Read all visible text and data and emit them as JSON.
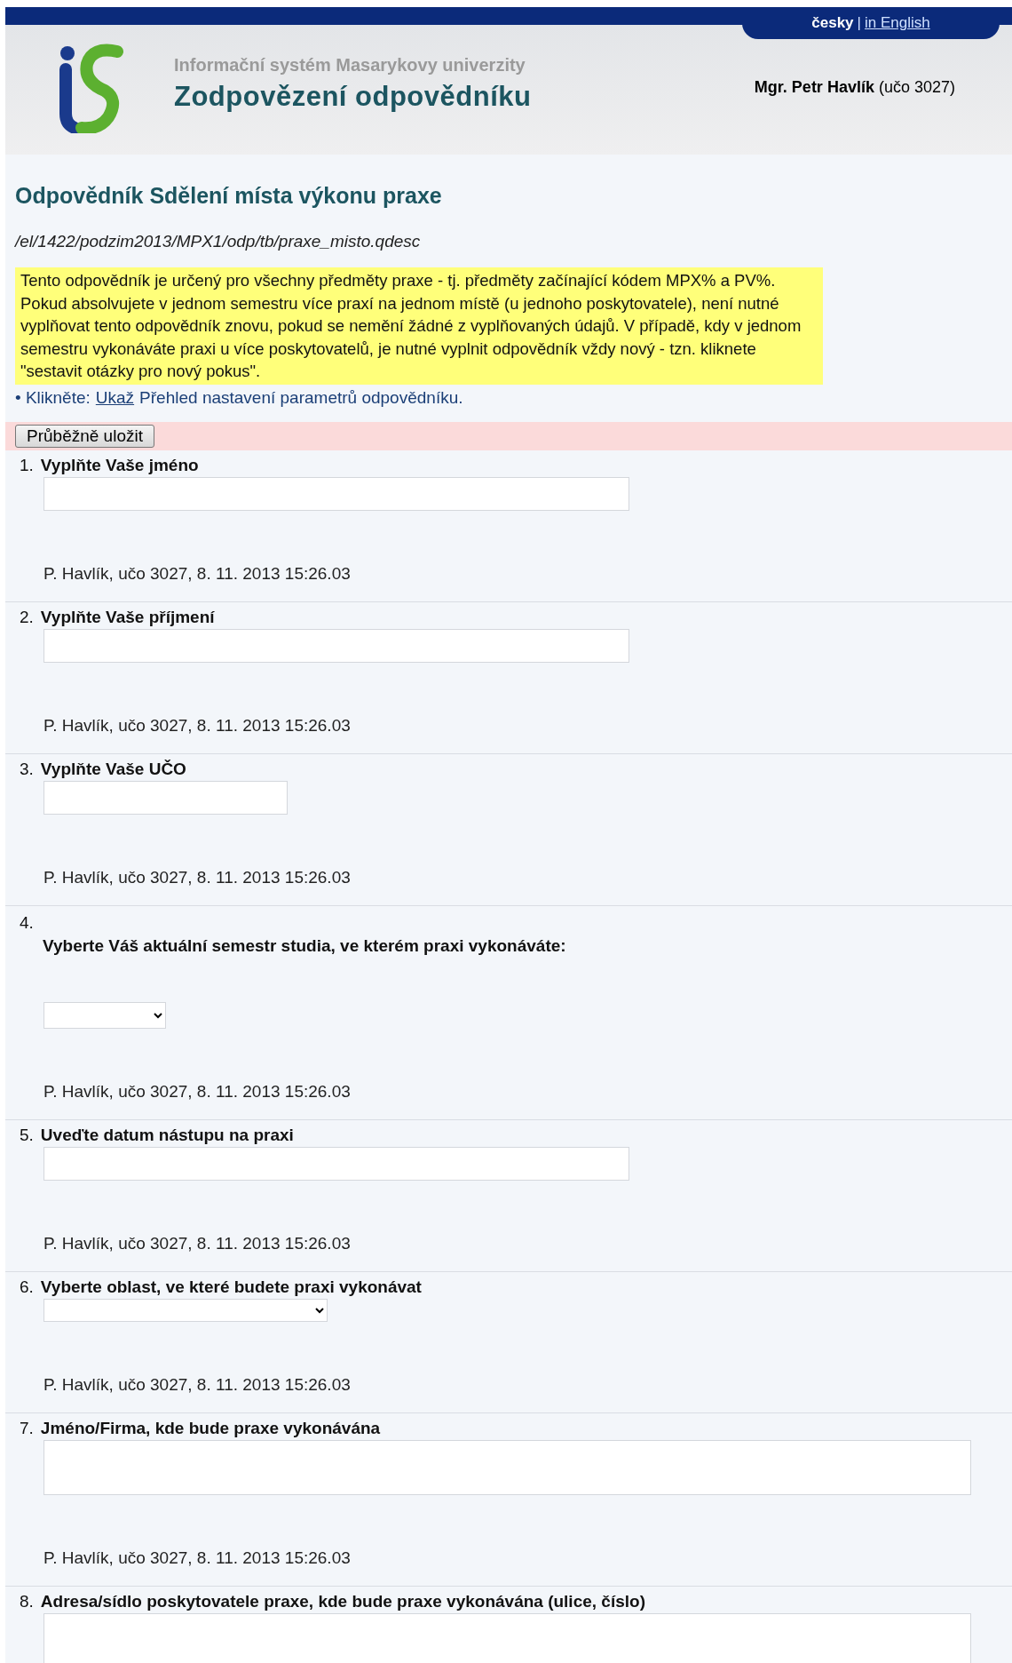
{
  "header": {
    "language_separator": "|",
    "languages": [
      {
        "label": "česky",
        "selected": true
      },
      {
        "label": "in English",
        "selected": false
      }
    ],
    "system_name": "Informační systém Masarykovy univerzity",
    "page_title": "Zodpovězení odpovědníku",
    "user": {
      "name": "Mgr. Petr Havlík",
      "id": "(učo 3027)"
    }
  },
  "form_title": "Odpovědník Sdělení místa výkonu praxe",
  "path": "/el/1422/podzim2013/MPX1/odp/tb/praxe_misto.qdesc",
  "notice": "Tento odpovědník je určený pro všechny předměty praxe - tj. předměty začínající kódem MPX% a PV%. Pokud absolvujete v jednom semestru více praxí na jednom místě (u jednoho poskytovatele), není nutné vyplňovat tento odpovědník znovu, pokud se nemění žádné z vyplňovaných údajů. V případě, kdy v jednom semestru vykonáváte praxi u více poskytovatelů, je nutné vyplnit odpovědník vždy nový - tzn. kliknete \"sestavit otázky pro nový pokus\".",
  "settings_link": {
    "bullet": "•",
    "prefix": "Klikněte:",
    "link": "Ukaž",
    "text": "Přehled nastavení parametrů odpovědníku."
  },
  "save_button": "Průběžně uložit",
  "questions": [
    {
      "number": "1.",
      "label": "Vyplňte Vaše jméno",
      "label_on_new_line": false,
      "field": {
        "kind": "text_long"
      },
      "meta": "P. Havlík, učo 3027, 8. 11. 2013 15:26.03"
    },
    {
      "number": "2.",
      "label": "Vyplňte Vaše příjmení",
      "label_on_new_line": false,
      "field": {
        "kind": "text_long"
      },
      "meta": "P. Havlík, učo 3027, 8. 11. 2013 15:26.03"
    },
    {
      "number": "3.",
      "label": "Vyplňte Vaše UČO",
      "label_on_new_line": false,
      "field": {
        "kind": "text_short"
      },
      "meta": "P. Havlík, učo 3027, 8. 11. 2013 15:26.03"
    },
    {
      "number": "4.",
      "label": "Vyberte Váš aktuální semestr studia, ve kterém praxi vykonáváte:",
      "label_on_new_line": true,
      "field": {
        "kind": "select_short"
      },
      "meta": "P. Havlík, učo 3027, 8. 11. 2013 15:26.03"
    },
    {
      "number": "5.",
      "label": "Uveďte datum nástupu na praxi",
      "label_on_new_line": false,
      "field": {
        "kind": "text_long"
      },
      "meta": "P. Havlík, učo 3027, 8. 11. 2013 15:26.03"
    },
    {
      "number": "6.",
      "label": "Vyberte oblast, ve které budete praxi vykonávat",
      "label_on_new_line": false,
      "field": {
        "kind": "select_long"
      },
      "meta": "P. Havlík, učo 3027, 8. 11. 2013 15:26.03"
    },
    {
      "number": "7.",
      "label": "Jméno/Firma, kde bude praxe vykonávána",
      "label_on_new_line": false,
      "field": {
        "kind": "textarea"
      },
      "meta": "P. Havlík, učo 3027, 8. 11. 2013 15:26.03"
    },
    {
      "number": "8.",
      "label": "Adresa/sídlo poskytovatele praxe, kde bude praxe vykonávána (ulice, číslo)",
      "label_on_new_line": false,
      "field": {
        "kind": "textarea"
      }
    }
  ]
}
